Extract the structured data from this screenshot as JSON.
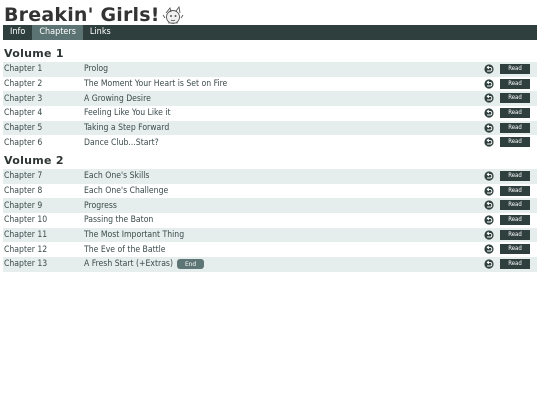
{
  "header": {
    "title": "Breakin' Girls!"
  },
  "nav": {
    "tabs": [
      "Info",
      "Chapters",
      "Links"
    ],
    "active": "Chapters"
  },
  "volumes": [
    {
      "title": "Volume 1",
      "chapters": [
        {
          "num": "Chapter 1",
          "title": "Prolog"
        },
        {
          "num": "Chapter 2",
          "title": "The Moment Your Heart is Set on Fire"
        },
        {
          "num": "Chapter 3",
          "title": "A Growing Desire"
        },
        {
          "num": "Chapter 4",
          "title": "Feeling Like You Like it"
        },
        {
          "num": "Chapter 5",
          "title": "Taking a Step Forward"
        },
        {
          "num": "Chapter 6",
          "title": "Dance Club...Start?"
        }
      ]
    },
    {
      "title": "Volume 2",
      "chapters": [
        {
          "num": "Chapter 7",
          "title": "Each One's Skills"
        },
        {
          "num": "Chapter 8",
          "title": "Each One's Challenge"
        },
        {
          "num": "Chapter 9",
          "title": "Progress"
        },
        {
          "num": "Chapter 10",
          "title": "Passing the Baton"
        },
        {
          "num": "Chapter 11",
          "title": "The Most Important Thing"
        },
        {
          "num": "Chapter 12",
          "title": "The Eve of the Battle"
        },
        {
          "num": "Chapter 13",
          "title": "A Fresh Start (+Extras)",
          "badge": "End"
        }
      ]
    }
  ],
  "labels": {
    "read": "Read"
  },
  "icons": {
    "logo": "mascot-icon",
    "history": "undo-arrow-icon"
  },
  "colors": {
    "nav_bg": "#2f3f3e",
    "nav_active": "#5b7473",
    "row_shade": "#e5eded",
    "read_bg": "#2f3f3e"
  }
}
